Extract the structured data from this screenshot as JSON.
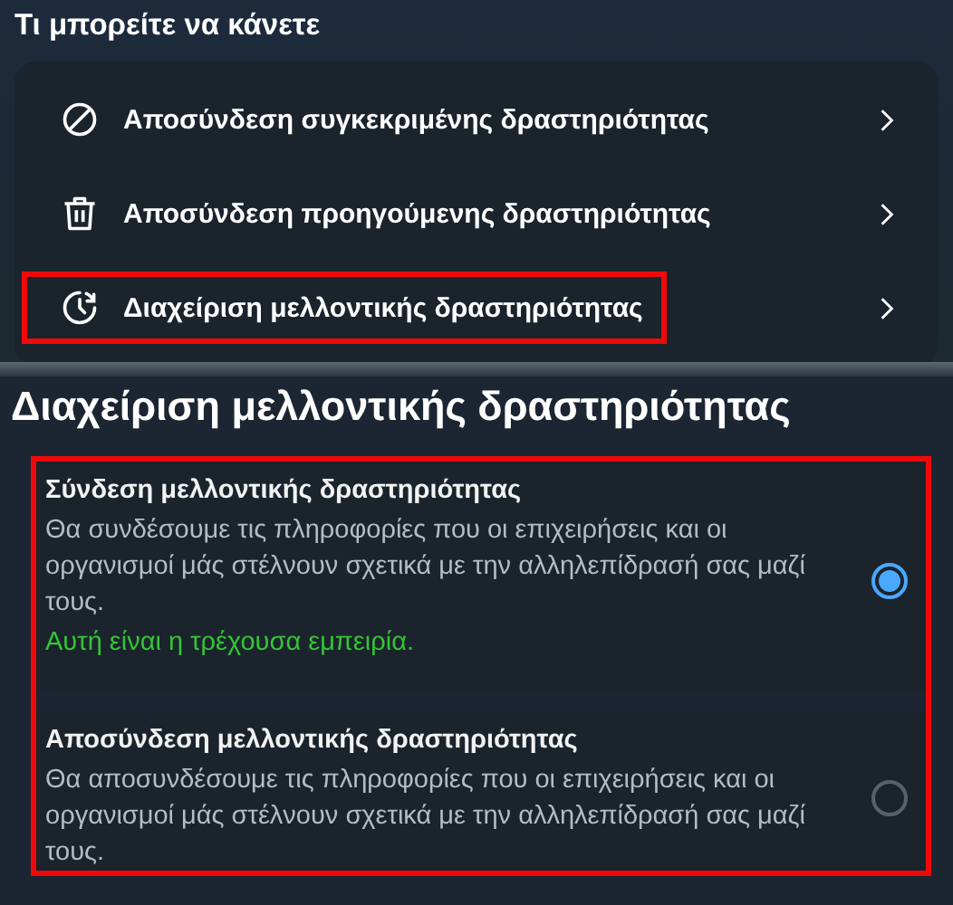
{
  "actions_section": {
    "title": "Τι μπορείτε να κάνετε",
    "items": [
      {
        "kind": "block",
        "label": "Αποσύνδεση συγκεκριμένης δραστηριότητας",
        "highlighted": false
      },
      {
        "kind": "trash",
        "label": "Αποσύνδεση προηγούμενης δραστηριότητας",
        "highlighted": false
      },
      {
        "kind": "clock",
        "label": "Διαχείριση μελλοντικής δραστηριότητας",
        "highlighted": true
      }
    ]
  },
  "future_section": {
    "title": "Διαχείριση μελλοντικής δραστηριότητας",
    "highlighted": true,
    "options": [
      {
        "title": "Σύνδεση μελλοντικής δραστηριότητας",
        "description": "Θα συνδέσουμε τις πληροφορίες που οι επιχειρήσεις και οι οργανισμοί μάς στέλνουν σχετικά με την αλληλεπίδρασή σας μαζί τους.",
        "note": "Αυτή είναι η τρέχουσα εμπειρία.",
        "selected": true
      },
      {
        "title": "Αποσύνδεση μελλοντικής δραστηριότητας",
        "description": "Θα αποσυνδέσουμε τις πληροφορίες που οι επιχειρήσεις και οι οργανισμοί μάς στέλνουν σχετικά με την αλληλεπίδρασή σας μαζί τους.",
        "selected": false
      }
    ]
  }
}
